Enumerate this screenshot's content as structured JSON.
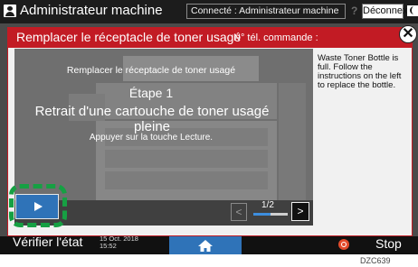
{
  "header": {
    "title": "Administrateur machine",
    "connection": "Connecté : Administrateur machine",
    "help_icon": "?",
    "logout_label": "Déconnexion"
  },
  "dialog": {
    "title": "Remplacer le réceptacle de toner usagé",
    "order_no_label": "N° tél. commande :",
    "close_icon": "✕",
    "video": {
      "step_title": "Remplacer le réceptacle de toner usagé",
      "step_no": "Étape 1",
      "step_desc": "Retrait d'une cartouche de toner usagé pleine",
      "hint": "Appuyer sur la touche Lecture.",
      "page": "1/2",
      "progress": 0.5
    },
    "message": "Waste Toner Bottle is full. Follow the instructions on the left to replace the bottle."
  },
  "footer": {
    "status_label": "Vérifier l'état",
    "date": "15 Oct. 2018",
    "time": "15:52",
    "stop_label": "Stop"
  },
  "figure_code": "DZC639"
}
